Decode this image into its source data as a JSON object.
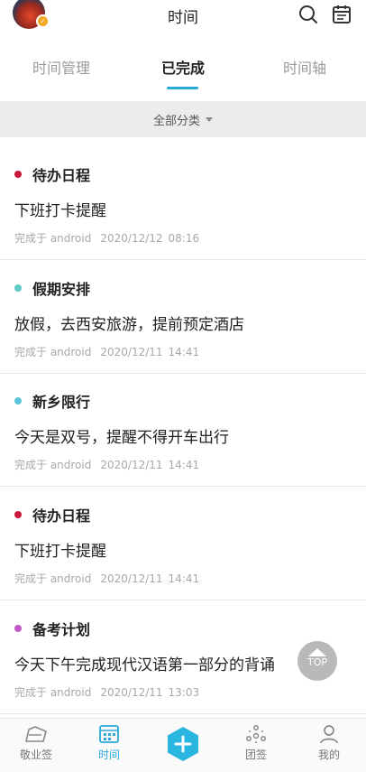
{
  "header": {
    "title": "时间",
    "avatar_badge": "✓"
  },
  "tabs": [
    {
      "label": "时间管理",
      "active": false
    },
    {
      "label": "已完成",
      "active": true
    },
    {
      "label": "时间轴",
      "active": false
    }
  ],
  "filter": {
    "label": "全部分类"
  },
  "items": [
    {
      "category": "待办日程",
      "dot_color": "#c8163b",
      "content": "下班打卡提醒",
      "source": "完成于 android",
      "date": "2020/12/12",
      "time": "08:16"
    },
    {
      "category": "假期安排",
      "dot_color": "#5fc9c4",
      "content": "放假，去西安旅游，提前预定酒店",
      "source": "完成于 android",
      "date": "2020/12/11",
      "time": "14:41"
    },
    {
      "category": "新乡限行",
      "dot_color": "#5bc6d6",
      "content": "今天是双号，提醒不得开车出行",
      "source": "完成于 android",
      "date": "2020/12/11",
      "time": "14:41"
    },
    {
      "category": "待办日程",
      "dot_color": "#c8163b",
      "content": "下班打卡提醒",
      "source": "完成于 android",
      "date": "2020/12/11",
      "time": "14:41"
    },
    {
      "category": "备考计划",
      "dot_color": "#c05ac8",
      "content": "今天下午完成现代汉语第一部分的背诵",
      "source": "完成于 android",
      "date": "2020/12/11",
      "time": "13:03"
    }
  ],
  "top_button": {
    "label": "TOP"
  },
  "bottom_nav": [
    {
      "label": "敬业签",
      "icon": "tag-icon",
      "active": false
    },
    {
      "label": "时间",
      "icon": "calendar-icon",
      "active": true
    },
    {
      "label": "",
      "icon": "add-icon",
      "active": false
    },
    {
      "label": "团签",
      "icon": "team-icon",
      "active": false
    },
    {
      "label": "我的",
      "icon": "user-icon",
      "active": false
    }
  ],
  "colors": {
    "accent": "#29a9d6",
    "filter_bg": "#ececec"
  }
}
